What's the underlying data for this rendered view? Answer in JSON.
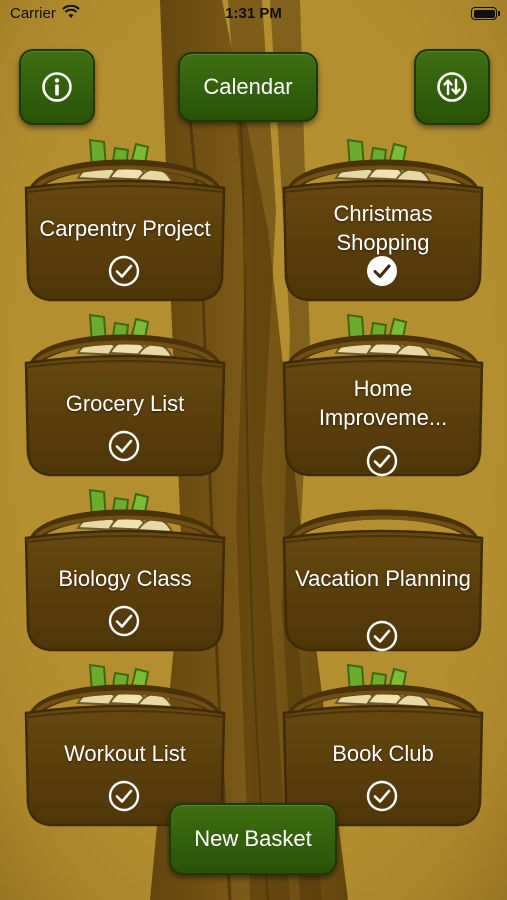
{
  "status_bar": {
    "carrier": "Carrier",
    "time": "1:31 PM"
  },
  "toolbar": {
    "info_icon": "info-icon",
    "calendar_label": "Calendar",
    "sync_icon": "sync-icon"
  },
  "baskets": [
    {
      "label": "Carpentry Project",
      "checked": false,
      "has_produce": true
    },
    {
      "label": "Christmas Shopping",
      "checked": true,
      "has_produce": true
    },
    {
      "label": "Grocery List",
      "checked": false,
      "has_produce": true
    },
    {
      "label": "Home Improveme...",
      "checked": false,
      "has_produce": true
    },
    {
      "label": "Biology Class",
      "checked": false,
      "has_produce": true
    },
    {
      "label": "Vacation Planning",
      "checked": false,
      "has_produce": false
    },
    {
      "label": "Workout List",
      "checked": false,
      "has_produce": true
    },
    {
      "label": "Book Club",
      "checked": false,
      "has_produce": true
    }
  ],
  "footer": {
    "new_basket_label": "New Basket"
  },
  "colors": {
    "background": "#b08b2e",
    "trunk": "#6e4f12",
    "basket": "#5a3f0d",
    "button_green": "#36600e",
    "text": "#ffffff"
  }
}
